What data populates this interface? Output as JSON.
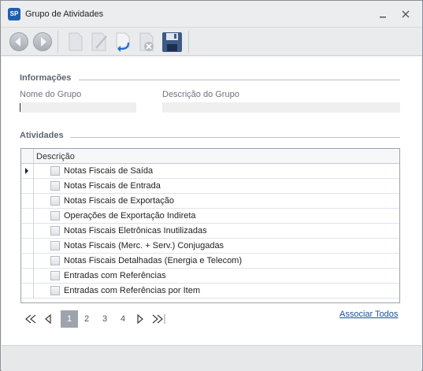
{
  "window": {
    "title": "Grupo de Atividades",
    "app_icon_text": "SP"
  },
  "toolbar": {
    "buttons": [
      {
        "name": "back",
        "icon": "arrow-left-icon"
      },
      {
        "name": "forward",
        "icon": "arrow-right-icon"
      },
      {
        "name": "new",
        "icon": "new-document-icon"
      },
      {
        "name": "edit",
        "icon": "edit-icon"
      },
      {
        "name": "undo",
        "icon": "undo-icon"
      },
      {
        "name": "delete",
        "icon": "delete-icon"
      },
      {
        "name": "save",
        "icon": "save-icon"
      }
    ]
  },
  "informacoes": {
    "section_title": "Informações",
    "nome_label": "Nome do Grupo",
    "nome_value": "",
    "descricao_label": "Descrição do Grupo",
    "descricao_value": ""
  },
  "atividades": {
    "section_title": "Atividades",
    "column_header": "Descrição",
    "rows": [
      {
        "label": "Notas Fiscais de Saída",
        "checked": false,
        "current": true
      },
      {
        "label": "Notas Fiscais de Entrada",
        "checked": false,
        "current": false
      },
      {
        "label": "Notas Fiscais de Exportação",
        "checked": false,
        "current": false
      },
      {
        "label": "Operações de Exportação Indireta",
        "checked": false,
        "current": false
      },
      {
        "label": "Notas Fiscais Eletrônicas Inutilizadas",
        "checked": false,
        "current": false
      },
      {
        "label": "Notas Fiscais (Merc. + Serv.) Conjugadas",
        "checked": false,
        "current": false
      },
      {
        "label": "Notas Fiscais Detalhadas (Energia e Telecom)",
        "checked": false,
        "current": false
      },
      {
        "label": "Entradas com Referências",
        "checked": false,
        "current": false
      },
      {
        "label": "Entradas com Referências por Item",
        "checked": false,
        "current": false
      }
    ]
  },
  "pager": {
    "pages": [
      "1",
      "2",
      "3",
      "4"
    ],
    "active_page": "1"
  },
  "associar_todos": "Associar Todos",
  "colors": {
    "link": "#1a4fa3",
    "active_page_bg": "#9da4ad",
    "section_title": "#5d6571"
  }
}
